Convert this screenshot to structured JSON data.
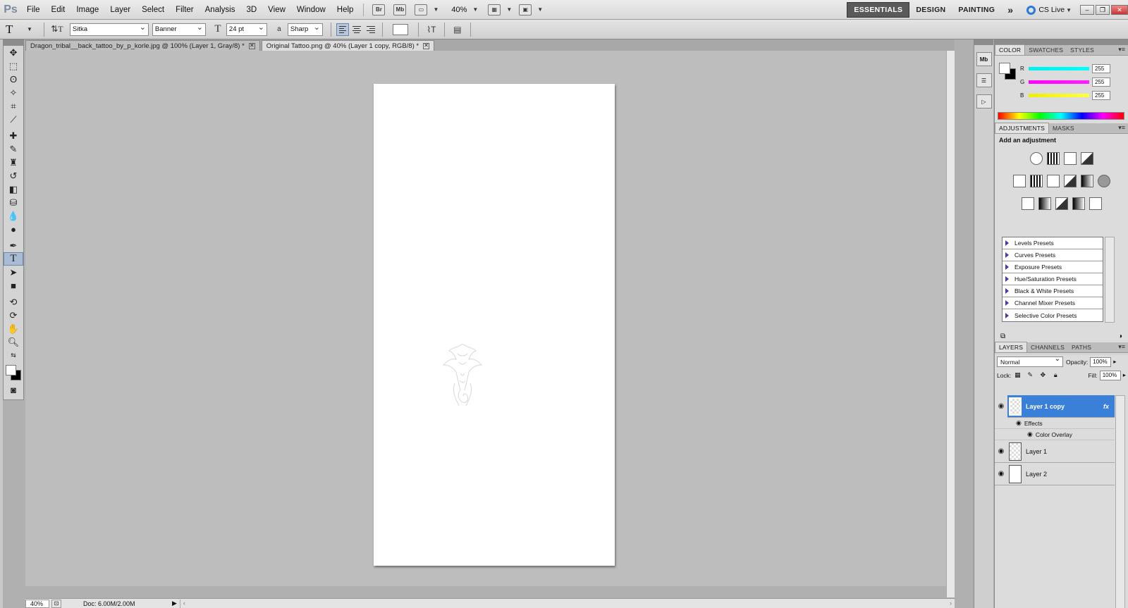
{
  "app": {
    "logo": "Ps"
  },
  "menu": [
    "File",
    "Edit",
    "Image",
    "Layer",
    "Select",
    "Filter",
    "Analysis",
    "3D",
    "View",
    "Window",
    "Help"
  ],
  "menubar": {
    "br_label": "Br",
    "mb_label": "Mb",
    "zoom": "40%"
  },
  "workspaces": {
    "essentials": "ESSENTIALS",
    "design": "DESIGN",
    "painting": "PAINTING",
    "more": "»",
    "cslive": "CS Live"
  },
  "options": {
    "tool_glyph": "T",
    "font_family": "Sitka",
    "font_style": "Banner",
    "font_size": "24 pt",
    "aa_label": "a",
    "antialias": "Sharp"
  },
  "tabs": [
    {
      "label": "Dragon_tribal__back_tattoo_by_p_korle.jpg @ 100% (Layer 1, Gray/8) *"
    },
    {
      "label": "Original Tattoo.png @ 40% (Layer 1 copy, RGB/8) *"
    }
  ],
  "status": {
    "zoom": "40%",
    "doc": "Doc: 6.00M/2.00M"
  },
  "color_panel": {
    "tabs": [
      "COLOR",
      "SWATCHES",
      "STYLES"
    ],
    "r": "255",
    "g": "255",
    "b": "255",
    "r_label": "R",
    "g_label": "G",
    "b_label": "B",
    "r_color": "#00e5e5",
    "g_color": "#e500e5",
    "b_color": "#e5e500"
  },
  "adjustments": {
    "tabs": [
      "ADJUSTMENTS",
      "MASKS"
    ],
    "title": "Add an adjustment",
    "presets": [
      "Levels Presets",
      "Curves Presets",
      "Exposure Presets",
      "Hue/Saturation Presets",
      "Black & White Presets",
      "Channel Mixer Presets",
      "Selective Color Presets"
    ]
  },
  "layers": {
    "tabs": [
      "LAYERS",
      "CHANNELS",
      "PATHS"
    ],
    "blend_mode": "Normal",
    "opacity_label": "Opacity:",
    "opacity": "100%",
    "lock_label": "Lock:",
    "fill_label": "Fill:",
    "fill": "100%",
    "items": [
      {
        "name": "Layer 1 copy",
        "fx": "fx"
      },
      {
        "name": "Layer 1"
      },
      {
        "name": "Layer 2"
      }
    ],
    "effects_label": "Effects",
    "color_overlay_label": "Color Overlay"
  },
  "accent_color": "#3a7fd8"
}
